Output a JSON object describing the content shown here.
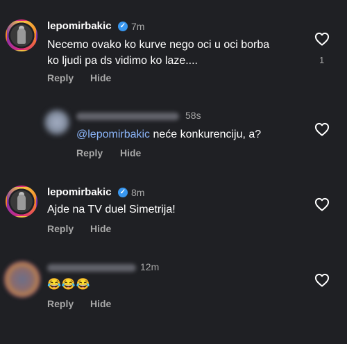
{
  "comments": [
    {
      "username": "lepomirbakic",
      "time": "7m",
      "text": "Necemo ovako ko kurve nego oci u oci borba ko ljudi pa ds vidimo ko laze....",
      "reply_label": "Reply",
      "hide_label": "Hide",
      "likes": "1"
    },
    {
      "time": "58s",
      "mention": "@lepomirbakic",
      "text": " neće konkurenciju, a?",
      "reply_label": "Reply",
      "hide_label": "Hide"
    },
    {
      "username": "lepomirbakic",
      "time": "8m",
      "text": "Ajde na TV duel Simetrija!",
      "reply_label": "Reply",
      "hide_label": "Hide"
    },
    {
      "time": "12m",
      "text": "😂😂😂",
      "reply_label": "Reply",
      "hide_label": "Hide"
    }
  ],
  "icons": {
    "verified": "verified-badge-icon",
    "like": "heart-outline-icon"
  },
  "colors": {
    "background": "#1f2024",
    "mention": "#8ab4f8",
    "verified": "#3897f0",
    "secondary_text": "#a8a8a8"
  }
}
